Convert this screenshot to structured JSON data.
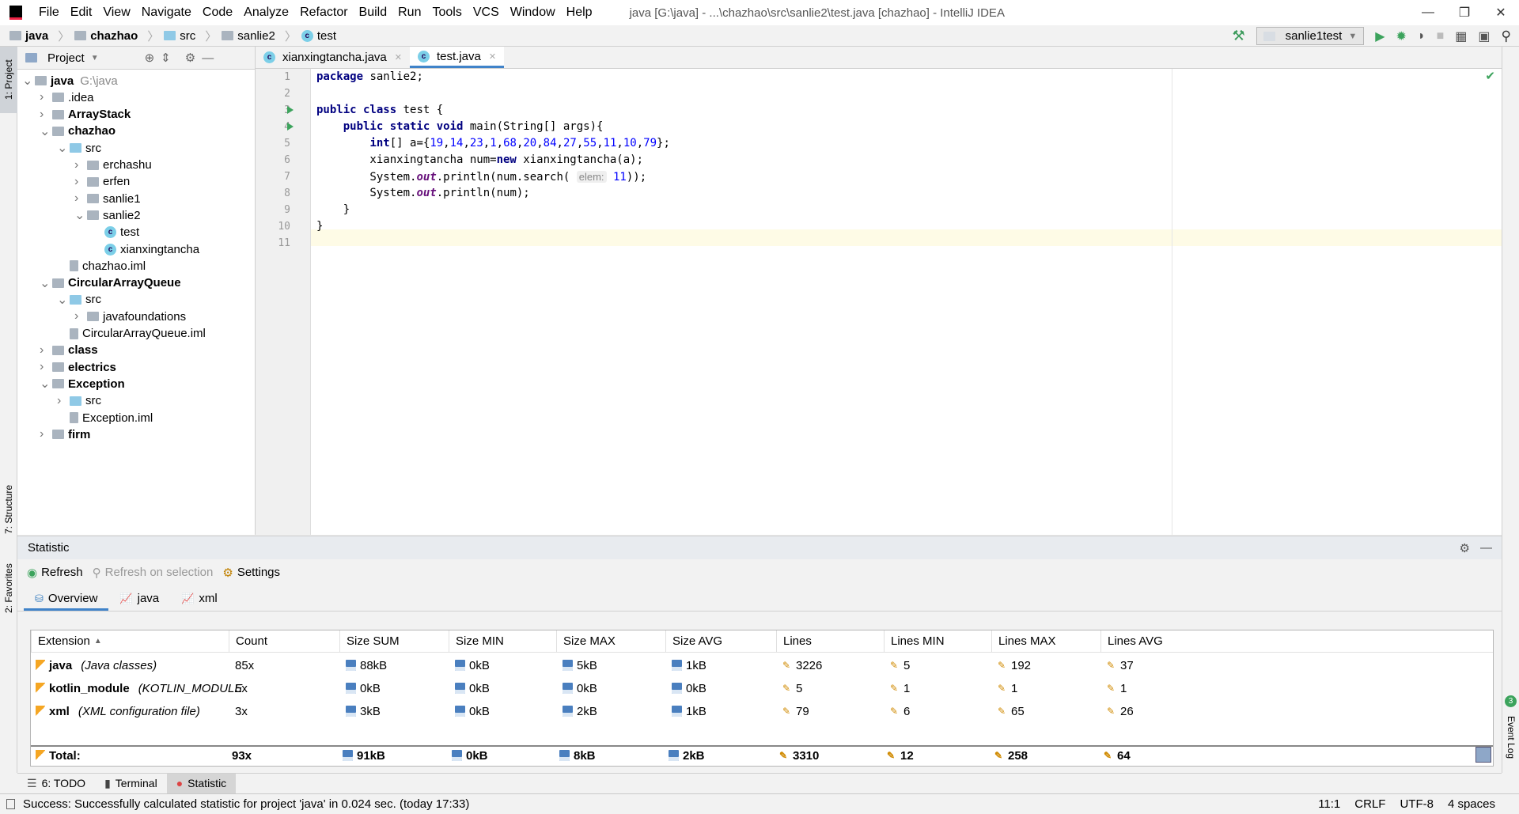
{
  "window": {
    "title": "java [G:\\java] - ...\\chazhao\\src\\sanlie2\\test.java [chazhao] - IntelliJ IDEA"
  },
  "menu": [
    "File",
    "Edit",
    "View",
    "Navigate",
    "Code",
    "Analyze",
    "Refactor",
    "Build",
    "Run",
    "Tools",
    "VCS",
    "Window",
    "Help"
  ],
  "breadcrumb": [
    "java",
    "chazhao",
    "src",
    "sanlie2",
    "test"
  ],
  "run_config": "sanlie1test",
  "left_stripe": {
    "project": "1: Project",
    "structure": "7: Structure",
    "favorites": "2: Favorites"
  },
  "right_stripe": {
    "event_log": "Event Log",
    "event_count": "3"
  },
  "project": {
    "title": "Project",
    "tree": [
      {
        "label": "java",
        "hint": "G:\\java",
        "level": 0,
        "type": "module",
        "open": true,
        "bold": true
      },
      {
        "label": ".idea",
        "level": 1,
        "type": "folder"
      },
      {
        "label": "ArrayStack",
        "level": 1,
        "type": "module",
        "bold": true
      },
      {
        "label": "chazhao",
        "level": 1,
        "type": "module",
        "open": true,
        "bold": true
      },
      {
        "label": "src",
        "level": 2,
        "type": "src",
        "open": true
      },
      {
        "label": "erchashu",
        "level": 3,
        "type": "package"
      },
      {
        "label": "erfen",
        "level": 3,
        "type": "package"
      },
      {
        "label": "sanlie1",
        "level": 3,
        "type": "package"
      },
      {
        "label": "sanlie2",
        "level": 3,
        "type": "package",
        "open": true
      },
      {
        "label": "test",
        "level": 4,
        "type": "class"
      },
      {
        "label": "xianxingtancha",
        "level": 4,
        "type": "class"
      },
      {
        "label": "chazhao.iml",
        "level": 2,
        "type": "iml"
      },
      {
        "label": "CircularArrayQueue",
        "level": 1,
        "type": "module",
        "open": true,
        "bold": true
      },
      {
        "label": "src",
        "level": 2,
        "type": "src",
        "open": true
      },
      {
        "label": "javafoundations",
        "level": 3,
        "type": "package"
      },
      {
        "label": "CircularArrayQueue.iml",
        "level": 2,
        "type": "iml"
      },
      {
        "label": "class",
        "level": 1,
        "type": "module",
        "bold": true
      },
      {
        "label": "electrics",
        "level": 1,
        "type": "module",
        "bold": true
      },
      {
        "label": "Exception",
        "level": 1,
        "type": "module",
        "open": true,
        "bold": true
      },
      {
        "label": "src",
        "level": 2,
        "type": "src"
      },
      {
        "label": "Exception.iml",
        "level": 2,
        "type": "iml"
      },
      {
        "label": "firm",
        "level": 1,
        "type": "module",
        "bold": true
      }
    ]
  },
  "editor": {
    "tabs": [
      {
        "label": "xianxingtancha.java",
        "active": false
      },
      {
        "label": "test.java",
        "active": true
      }
    ],
    "lines": [
      "<span class='kw'>package</span> sanlie2;",
      "",
      "<span class='kw'>public class</span> test {",
      "    <span class='kw'>public static void</span> main(String[] args){",
      "        <span class='kw'>int</span>[] a={<span class='num'>19</span>,<span class='num'>14</span>,<span class='num'>23</span>,<span class='num'>1</span>,<span class='num'>68</span>,<span class='num'>20</span>,<span class='num'>84</span>,<span class='num'>27</span>,<span class='num'>55</span>,<span class='num'>11</span>,<span class='num'>10</span>,<span class='num'>79</span>};",
      "        xianxingtancha num=<span class='kw'>new</span> xianxingtancha(a);",
      "        System.<span class='st'>out</span>.println(num.search( <span class='inlay'>elem:</span> <span class='num'>11</span>));",
      "        System.<span class='st'>out</span>.println(num);",
      "    }",
      "}",
      ""
    ],
    "run_lines": [
      3,
      4
    ],
    "current_line": 11
  },
  "statistic": {
    "title": "Statistic",
    "toolbar": {
      "refresh": "Refresh",
      "refresh_sel": "Refresh on selection",
      "settings": "Settings"
    },
    "tabs": [
      "Overview",
      "java",
      "xml"
    ],
    "columns": [
      "Extension",
      "Count",
      "Size SUM",
      "Size MIN",
      "Size MAX",
      "Size AVG",
      "Lines",
      "Lines MIN",
      "Lines MAX",
      "Lines AVG"
    ],
    "rows": [
      {
        "ext": "java",
        "desc": "(Java classes)",
        "values": [
          "85x",
          "88kB",
          "0kB",
          "5kB",
          "1kB",
          "3226",
          "5",
          "192",
          "37"
        ]
      },
      {
        "ext": "kotlin_module",
        "desc": "(KOTLIN_MODULE",
        "values": [
          "5x",
          "0kB",
          "0kB",
          "0kB",
          "0kB",
          "5",
          "1",
          "1",
          "1"
        ]
      },
      {
        "ext": "xml",
        "desc": "(XML configuration file)",
        "values": [
          "3x",
          "3kB",
          "0kB",
          "2kB",
          "1kB",
          "79",
          "6",
          "65",
          "26"
        ]
      }
    ],
    "total": {
      "label": "Total:",
      "values": [
        "93x",
        "91kB",
        "0kB",
        "8kB",
        "2kB",
        "3310",
        "12",
        "258",
        "64"
      ]
    }
  },
  "bottom_tabs": [
    {
      "label": "6: TODO"
    },
    {
      "label": "Terminal"
    },
    {
      "label": "Statistic",
      "active": true
    }
  ],
  "status": {
    "message": "Success: Successfully calculated statistic for project 'java' in 0.024 sec. (today 17:33)",
    "position": "11:1",
    "line_sep": "CRLF",
    "encoding": "UTF-8",
    "indent": "4 spaces"
  }
}
